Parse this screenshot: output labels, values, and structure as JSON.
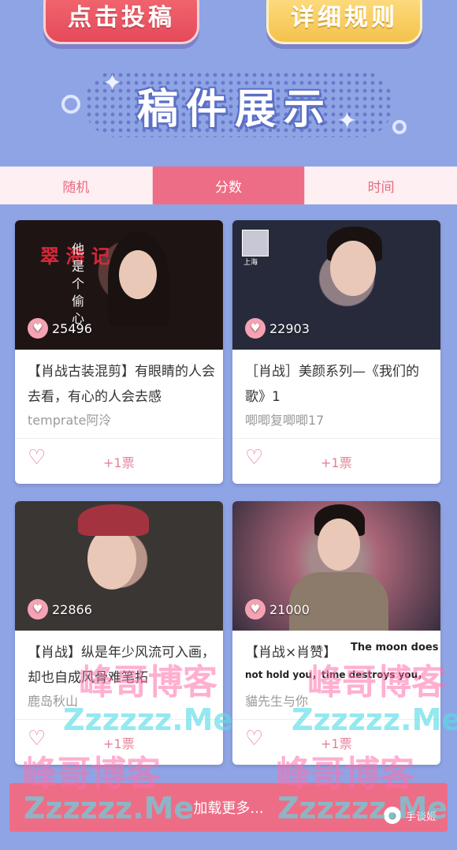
{
  "top_buttons": {
    "submit": "点击投稿",
    "rules": "详细规则"
  },
  "section_title": "稿件展示",
  "tabs": [
    {
      "label": "随机",
      "active": false
    },
    {
      "label": "分数",
      "active": true
    },
    {
      "label": "时间",
      "active": false
    }
  ],
  "cards": [
    {
      "likes": "25496",
      "title": "【肖战古装混剪】有眼睛的人会去看，有心的人会去感",
      "author": "temprate阿泠",
      "vote": "+1票",
      "overlay_vertical": "他是个偷心",
      "overlay_red": "翠 海 记"
    },
    {
      "likes": "22903",
      "title": "［肖战］美颜系列—《我们的歌》1",
      "author": "唧唧复唧唧17",
      "vote": "+1票",
      "overlay_small": "上海"
    },
    {
      "likes": "22866",
      "title": "【肖战】纵是年少风流可入画，却也自成风骨难笔拓",
      "author": "鹿岛秋山",
      "vote": "+1票"
    },
    {
      "likes": "21000",
      "title": "【肖战×肖赞】",
      "title_overlay_1": "The moon does",
      "title_overlay_2": "not hold you，time destroys you，",
      "author": "貓先生与你",
      "vote": "+1票"
    }
  ],
  "load_more": "加载更多...",
  "watermark": {
    "cn": "峰哥博客",
    "en": "Zzzzzz.Me"
  },
  "corner_tag": "手谈姬",
  "colors": {
    "background": "#8fa4e4",
    "accent": "#ee6d86",
    "tab_inactive_text": "#ea6a82"
  },
  "icons": {
    "like": "heart-outline-icon",
    "likes_badge": "heart-icon",
    "corner": "wechat-icon"
  }
}
